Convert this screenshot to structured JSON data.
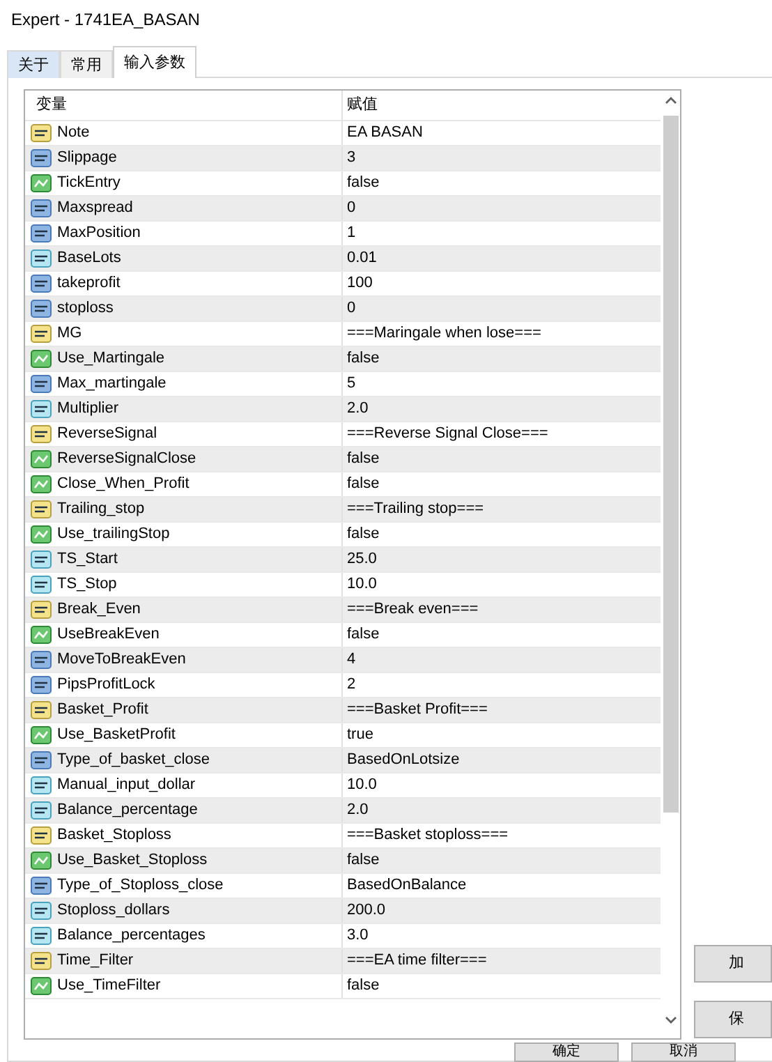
{
  "window": {
    "title": "Expert - 1741EA_BASAN"
  },
  "tabs": [
    {
      "label": "关于",
      "selected": false
    },
    {
      "label": "常用",
      "selected": false
    },
    {
      "label": "输入参数",
      "selected": true
    }
  ],
  "table": {
    "columns": [
      "变量",
      "赋值"
    ],
    "rows": [
      {
        "kind": "string",
        "name": "Note",
        "value": "EA BASAN"
      },
      {
        "kind": "int",
        "name": "Slippage",
        "value": "3"
      },
      {
        "kind": "bool",
        "name": "TickEntry",
        "value": "false"
      },
      {
        "kind": "int",
        "name": "Maxspread",
        "value": "0"
      },
      {
        "kind": "int",
        "name": "MaxPosition",
        "value": "1"
      },
      {
        "kind": "double",
        "name": "BaseLots",
        "value": "0.01"
      },
      {
        "kind": "int",
        "name": "takeprofit",
        "value": "100"
      },
      {
        "kind": "int",
        "name": "stoploss",
        "value": "0"
      },
      {
        "kind": "string",
        "name": "MG",
        "value": "===Maringale when lose==="
      },
      {
        "kind": "bool",
        "name": "Use_Martingale",
        "value": "false"
      },
      {
        "kind": "int",
        "name": "Max_martingale",
        "value": "5"
      },
      {
        "kind": "double",
        "name": "Multiplier",
        "value": "2.0"
      },
      {
        "kind": "string",
        "name": "ReverseSignal",
        "value": "===Reverse Signal Close==="
      },
      {
        "kind": "bool",
        "name": "ReverseSignalClose",
        "value": "false"
      },
      {
        "kind": "bool",
        "name": "Close_When_Profit",
        "value": "false"
      },
      {
        "kind": "string",
        "name": "Trailing_stop",
        "value": "===Trailing stop==="
      },
      {
        "kind": "bool",
        "name": "Use_trailingStop",
        "value": "false"
      },
      {
        "kind": "double",
        "name": "TS_Start",
        "value": "25.0"
      },
      {
        "kind": "double",
        "name": "TS_Stop",
        "value": "10.0"
      },
      {
        "kind": "string",
        "name": "Break_Even",
        "value": "===Break even==="
      },
      {
        "kind": "bool",
        "name": "UseBreakEven",
        "value": "false"
      },
      {
        "kind": "int",
        "name": "MoveToBreakEven",
        "value": "4"
      },
      {
        "kind": "int",
        "name": "PipsProfitLock",
        "value": "2"
      },
      {
        "kind": "string",
        "name": "Basket_Profit",
        "value": "===Basket Profit==="
      },
      {
        "kind": "bool",
        "name": "Use_BasketProfit",
        "value": "true"
      },
      {
        "kind": "int",
        "name": "Type_of_basket_close",
        "value": "BasedOnLotsize"
      },
      {
        "kind": "double",
        "name": "Manual_input_dollar",
        "value": "10.0"
      },
      {
        "kind": "double",
        "name": "Balance_percentage",
        "value": "2.0"
      },
      {
        "kind": "string",
        "name": "Basket_Stoploss",
        "value": "===Basket stoploss==="
      },
      {
        "kind": "bool",
        "name": "Use_Basket_Stoploss",
        "value": "false"
      },
      {
        "kind": "int",
        "name": "Type_of_Stoploss_close",
        "value": "BasedOnBalance"
      },
      {
        "kind": "double",
        "name": "Stoploss_dollars",
        "value": "200.0"
      },
      {
        "kind": "double",
        "name": "Balance_percentages",
        "value": "3.0"
      },
      {
        "kind": "string",
        "name": "Time_Filter",
        "value": "===EA time filter==="
      },
      {
        "kind": "bool",
        "name": "Use_TimeFilter",
        "value": "false"
      }
    ]
  },
  "side_buttons": [
    "加",
    "保"
  ],
  "bottom_buttons": [
    "确定",
    "取消"
  ]
}
